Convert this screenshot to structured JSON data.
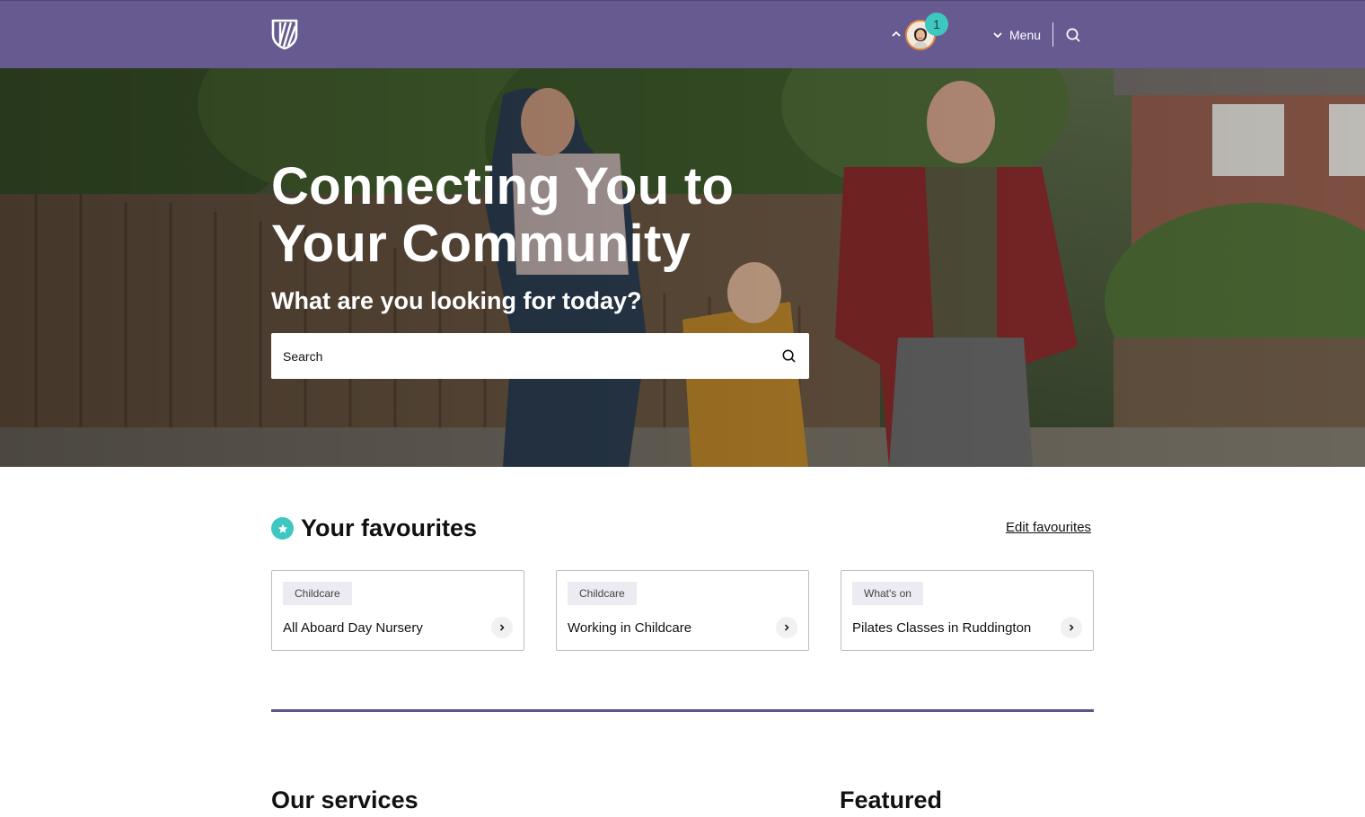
{
  "header": {
    "logo_icon": "shield-logo-icon",
    "collapse_icon": "chevron-up-icon",
    "notification_count": "1",
    "menu_label": "Menu",
    "menu_icon": "chevron-down-icon",
    "search_icon": "search-icon",
    "colors": {
      "bar": "#675a91",
      "badge": "#3ec6c1",
      "avatar_ring": "#e08a3a"
    }
  },
  "hero": {
    "title": "Connecting You to Your Community",
    "subtitle": "What are you looking for today?",
    "search": {
      "placeholder": "Search",
      "value": "",
      "icon": "search-icon"
    }
  },
  "favourites": {
    "icon": "star-icon",
    "title": "Your favourites",
    "edit_label": "Edit favourites",
    "cards": [
      {
        "tag": "Childcare",
        "name": "All Aboard Day Nursery",
        "icon": "chevron-right-icon"
      },
      {
        "tag": "Childcare",
        "name": "Working in Childcare",
        "icon": "chevron-right-icon"
      },
      {
        "tag": "What's on",
        "name": "Pilates Classes in Ruddington",
        "icon": "chevron-right-icon"
      }
    ]
  },
  "sections": {
    "services_title": "Our services",
    "featured_title": "Featured"
  },
  "colors": {
    "accent_teal": "#3ec6c1",
    "divider": "#5d5488"
  }
}
